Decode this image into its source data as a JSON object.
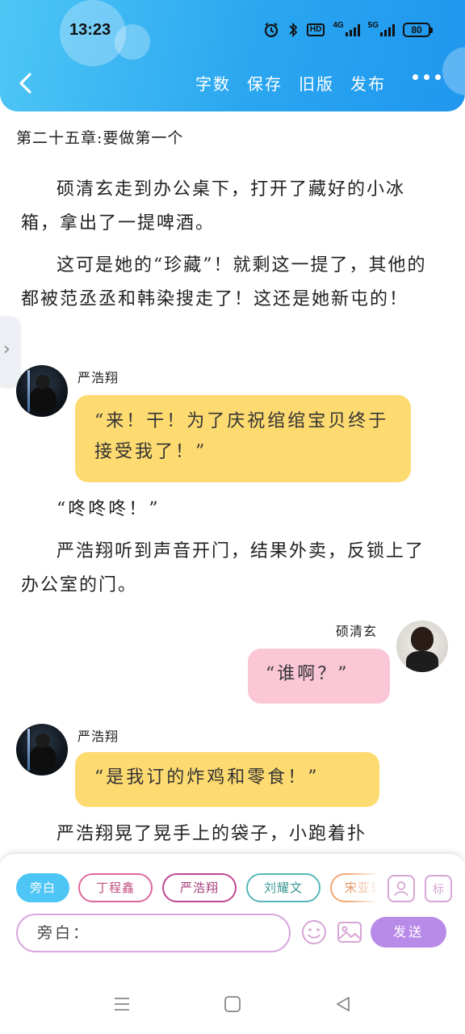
{
  "status_bar": {
    "time": "13:23",
    "network_hd": "HD",
    "network_4g": "4G",
    "network_5g": "5G",
    "battery": "80"
  },
  "toolbar": {
    "back_icon": "chevron-left-icon",
    "actions": [
      "字数",
      "保存",
      "旧版",
      "发布"
    ],
    "more_icon": "more-dots-icon"
  },
  "chapter": {
    "title": "第二十五章:要做第一个"
  },
  "story": {
    "p1": "硕清玄走到办公桌下，打开了藏好的小冰箱，拿出了一提啤酒。",
    "p2": "这可是她的“珍藏”！就剩这一提了，其他的都被范丞丞和韩染搜走了！这还是她新屯的！",
    "msg1_speaker": "严浩翔",
    "msg1_text": "“来！干！为了庆祝绾绾宝贝终于接受我了！”",
    "knock": "“咚咚咚！”",
    "p3": "严浩翔听到声音开门，结果外卖，反锁上了办公室的门。",
    "msg2_speaker": "硕清玄",
    "msg2_text": "“谁啊？”",
    "msg3_speaker": "严浩翔",
    "msg3_text": "“是我订的炸鸡和零食！”",
    "p4": "严浩翔晃了晃手上的袋子，小跑着扑"
  },
  "side_tab": {
    "glyph": "›"
  },
  "role_chips": [
    "旁白",
    "丁程鑫",
    "严浩翔",
    "刘耀文",
    "宋亚轩"
  ],
  "editor": {
    "input_value": "旁白：",
    "send_label": "发送",
    "tool_icons": [
      "person-card-icon",
      "tag-icon",
      "emoji-icon",
      "image-icon"
    ]
  },
  "colors": {
    "header_gradient_start": "#4ec6f5",
    "header_gradient_end": "#1f97ee",
    "bubble_yellow": "#fedb71",
    "bubble_pink": "#fbc7d6",
    "send_button": "#b98be8",
    "chip_active": "#4ec6f5"
  }
}
